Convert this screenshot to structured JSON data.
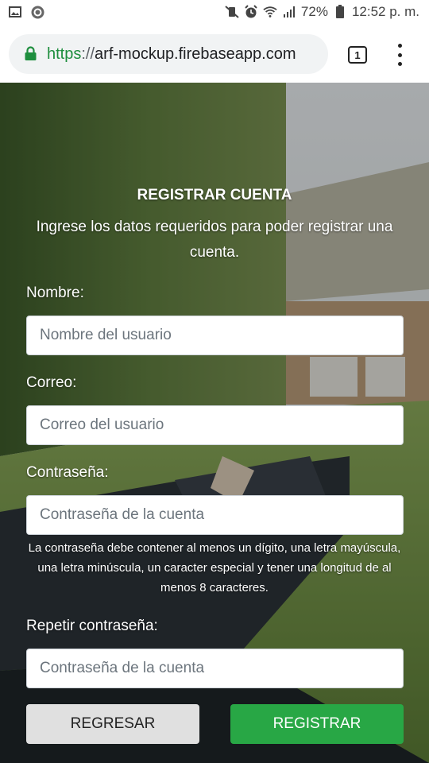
{
  "status_bar": {
    "battery": "72%",
    "time": "12:52 p. m.",
    "icons_left": [
      "image-icon",
      "sync-icon"
    ],
    "icons_right": [
      "mute-vibrate-icon",
      "alarm-icon",
      "wifi-icon",
      "signal-icon",
      "battery-icon"
    ]
  },
  "browser": {
    "url_scheme": "https",
    "url_separator": "://",
    "url_host": "arf-mockup.firebaseapp.com",
    "tab_count": "1",
    "secure_color": "#1e8e3e"
  },
  "form": {
    "title": "REGISTRAR CUENTA",
    "subtitle": "Ingrese los datos requeridos para poder registrar una cuenta.",
    "name_label": "Nombre:",
    "name_placeholder": "Nombre del usuario",
    "email_label": "Correo:",
    "email_placeholder": "Correo del usuario",
    "password_label": "Contraseña:",
    "password_placeholder": "Contraseña de la cuenta",
    "password_hint": "La contraseña debe contener al menos un dígito, una letra mayúscula, una letra minúscula, un caracter especial y tener una longitud de al menos 8 caracteres.",
    "repeat_password_label": "Repetir contraseña:",
    "repeat_password_placeholder": "Contraseña de la cuenta",
    "back_button": "REGRESAR",
    "register_button": "REGISTRAR"
  },
  "colors": {
    "register_button": "#28a745",
    "back_button": "#e0e0e0"
  }
}
